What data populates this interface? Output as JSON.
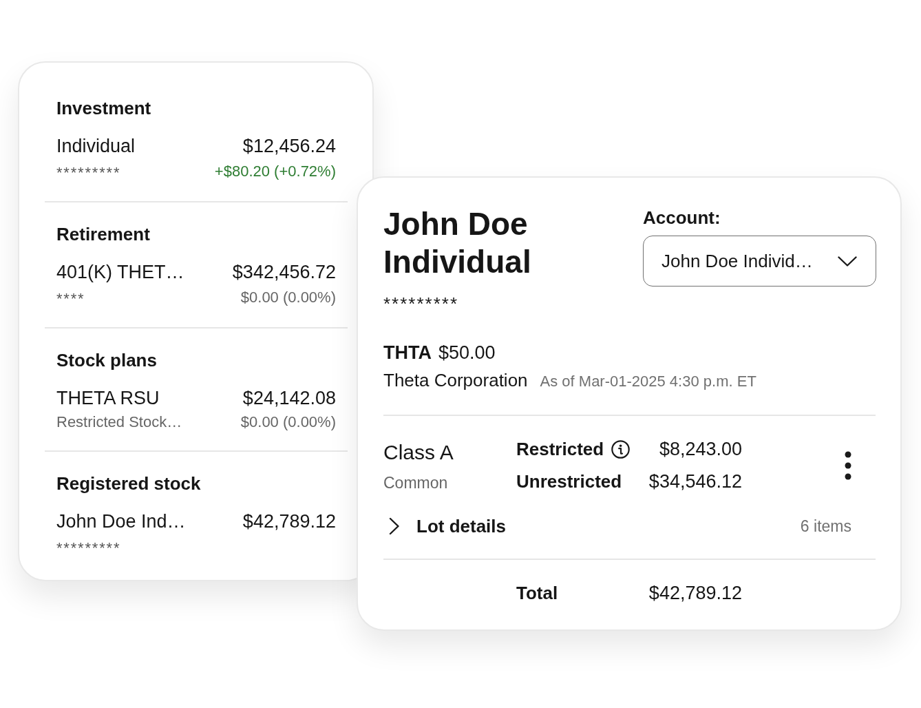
{
  "accounts_card": {
    "groups": [
      {
        "heading": "Investment",
        "accounts": [
          {
            "name": "Individual",
            "number": "*********",
            "balance": "$12,456.24",
            "change": "+$80.20 (+0.72%)",
            "gain": true
          }
        ]
      },
      {
        "heading": "Retirement",
        "accounts": [
          {
            "name": "401(K) THET…",
            "number": "****",
            "balance": "$342,456.72",
            "change": "$0.00 (0.00%)",
            "gain": false
          }
        ]
      },
      {
        "heading": "Stock plans",
        "accounts": [
          {
            "name": "THETA RSU",
            "description": "Restricted Stock…",
            "balance": "$24,142.08",
            "change": "$0.00 (0.00%)",
            "gain": false
          }
        ]
      },
      {
        "heading": "Registered stock",
        "accounts": [
          {
            "name": "John Doe Ind…",
            "number": "*********",
            "balance": "$42,789.12"
          }
        ]
      }
    ]
  },
  "detail_card": {
    "title": "John Doe Individual",
    "number": "*********",
    "account_select": {
      "label": "Account:",
      "value": "John Doe Individ…"
    },
    "quote": {
      "symbol": "THTA",
      "price": "$50.00",
      "company": "Theta Corporation",
      "as_of": "As of Mar-01-2025 4:30 p.m. ET"
    },
    "share_class": {
      "name": "Class A",
      "type": "Common",
      "lines": [
        {
          "label": "Restricted",
          "info": true,
          "value": "$8,243.00"
        },
        {
          "label": "Unrestricted",
          "info": false,
          "value": "$34,546.12"
        }
      ]
    },
    "lot_details": {
      "label": "Lot details",
      "count": "6 items",
      "expanded": false
    },
    "total": {
      "label": "Total",
      "value": "$42,789.12"
    }
  }
}
